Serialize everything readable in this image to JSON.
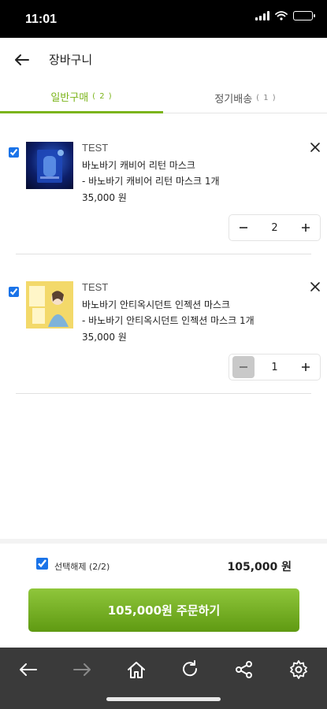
{
  "status_bar": {
    "time": "11:01"
  },
  "header": {
    "title": "장바구니"
  },
  "tabs": [
    {
      "label": "일반구매",
      "count": "( 2 )",
      "active": true
    },
    {
      "label": "정기배송",
      "count": "( 1 )",
      "active": false
    }
  ],
  "items": [
    {
      "brand": "TEST",
      "name": "바노바기 캐비어 리턴 마스크",
      "option": "- 바노바기 캐비어 리턴 마스크 1개",
      "price": "35,000 원",
      "quantity": "2",
      "checked": true
    },
    {
      "brand": "TEST",
      "name": "바노바기 안티옥시던트 인젝션 마스크",
      "option": "- 바노바기 안티옥시던트 인젝션 마스크 1개",
      "price": "35,000 원",
      "quantity": "1",
      "checked": true
    }
  ],
  "footer": {
    "select_label": "선택해제 (2/2)",
    "total": "105,000 원",
    "order_button": "105,000원 주문하기"
  },
  "colors": {
    "accent": "#7bb41a",
    "order_button": "#6fae1c",
    "browser_bar": "#3a3a3a"
  },
  "browser_toolbar": [
    "back-icon",
    "forward-icon",
    "home-icon",
    "refresh-icon",
    "share-icon",
    "settings-icon"
  ]
}
